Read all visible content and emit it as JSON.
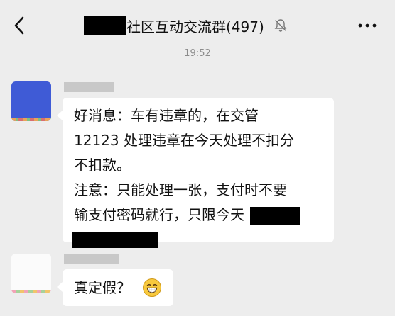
{
  "header": {
    "title": "社区互动交流群(497)",
    "back_icon": "chevron-left-icon",
    "mute_icon": "bell-muted-icon",
    "more_icon": "more-dots-icon"
  },
  "timestamp": "19:52",
  "messages": [
    {
      "lines": [
        "好消息：车有违章的，在交管",
        "12123 处理违章在今天处理不扣分",
        "不扣款。",
        "注意：只能处理一张，支付时不要",
        "输支付密码就行，只限今天"
      ]
    },
    {
      "text": "真定假？",
      "emoji": "grinning-face-icon"
    }
  ],
  "colors": {
    "background": "#ededed",
    "bubble": "#ffffff",
    "text": "#111111",
    "timestamp": "#8c8c8c",
    "avatar1": "#3f5bd6"
  }
}
